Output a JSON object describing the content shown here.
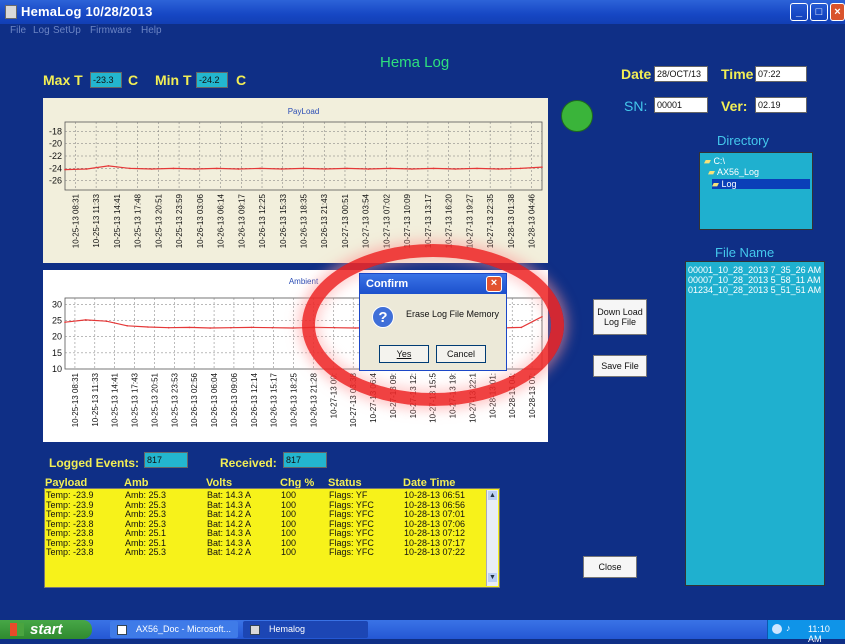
{
  "window": {
    "title": "HemaLog   10/28/2013"
  },
  "menu": [
    "File",
    "Log",
    "SetUp",
    "Firmware",
    "Help"
  ],
  "app_title": "Hema Log",
  "temps": {
    "max_label": "Max T",
    "max_value": "-23.3",
    "min_label": "Min T",
    "min_value": "-24.2",
    "unit": "C"
  },
  "device": {
    "date_label": "Date",
    "date_value": "28/OCT/13",
    "time_label": "Time",
    "time_value": "07:22",
    "sn_label": "SN:",
    "sn_value": "00001",
    "ver_label": "Ver:",
    "ver_value": "02.19"
  },
  "status_color": "#3ab43a",
  "directory": {
    "label": "Directory",
    "items": [
      "C:\\",
      "AX56_Log",
      "Log"
    ]
  },
  "files": {
    "label": "File Name",
    "items": [
      "00001_10_28_2013 7_35_26 AM",
      "00007_10_28_2013 5_58_11 AM",
      "01234_10_28_2013 5_51_51 AM"
    ]
  },
  "chart_data": [
    {
      "type": "line",
      "title": "PayLoad",
      "yticks": [
        -18,
        -20,
        -22,
        -24,
        -26
      ],
      "ylim": [
        -27.5,
        -16.5
      ],
      "xticks": [
        "10-25-13 08:31",
        "10-25-13 11:33",
        "10-25-13 14:41",
        "10-25-13 17:48",
        "10-25-13 20:51",
        "10-25-13 23:59",
        "10-26-13 03:06",
        "10-26-13 06:14",
        "10-26-13 09:17",
        "10-26-13 12:25",
        "10-26-13 15:33",
        "10-26-13 18:35",
        "10-26-13 21:43",
        "10-27-13 00:51",
        "10-27-13 03:54",
        "10-27-13 07:02",
        "10-27-13 10:09",
        "10-27-13 13:17",
        "10-27-13 16:20",
        "10-27-13 19:27",
        "10-27-13 22:35",
        "10-28-13 01:38",
        "10-28-13 04:46"
      ],
      "values": [
        -24.2,
        -24.1,
        -23.6,
        -24.0,
        -24.1,
        -24.0,
        -24.1,
        -24.0,
        -24.1,
        -24.0,
        -24.1,
        -24.0,
        -24.1,
        -24.0,
        -24.1,
        -24.0,
        -24.1,
        -24.0,
        -24.1,
        -24.0,
        -24.1,
        -24.0,
        -23.8
      ],
      "grid": true
    },
    {
      "type": "line",
      "title": "Ambient",
      "yticks": [
        30,
        25,
        20,
        15,
        10
      ],
      "ylim": [
        10,
        32
      ],
      "xticks": [
        "10-25-13 08:31",
        "10-25-13 11:33",
        "10-25-13 14:41",
        "10-25-13 17:43",
        "10-25-13 20:51",
        "10-25-13 23:53",
        "10-26-13 02:56",
        "10-26-13 06:04",
        "10-26-13 09:06",
        "10-26-13 12:14",
        "10-26-13 15:17",
        "10-26-13 18:25",
        "10-26-13 21:28",
        "10-27-13 00:",
        "10-27-13 03:38",
        "10-27-13 06:4",
        "10-27-13 09:",
        "10-27-13 12:",
        "10-27-13 15:5",
        "10-27-13 19:",
        "10-27-13 22:1",
        "10-28-13 01:",
        "10-28-13 04:",
        "10-28-13 07:"
      ],
      "values": [
        24.5,
        25.2,
        24.8,
        23.4,
        23.0,
        22.8,
        22.9,
        22.7,
        22.8,
        22.9,
        22.8,
        22.7,
        22.9,
        22.8,
        22.7,
        22.9,
        22.8,
        22.7,
        22.9,
        22.8,
        22.9,
        22.7,
        22.9,
        26.2
      ],
      "grid": true
    }
  ],
  "dialog": {
    "title": "Confirm",
    "message": "Erase Log File Memory",
    "yes": "Yes",
    "cancel": "Cancel"
  },
  "buttons": {
    "download": "Down Load\nLog File",
    "save": "Save File",
    "close": "Close"
  },
  "events": {
    "logged_label": "Logged Events:",
    "logged_value": "817",
    "received_label": "Received:",
    "received_value": "817"
  },
  "table": {
    "headers": [
      "Payload",
      "Amb",
      "Volts",
      "Chg %",
      "Status",
      "Date  Time"
    ],
    "rows": [
      [
        "Temp: -23.9",
        "Amb: 25.3",
        "Bat: 14.3  A",
        "100",
        "Flags: YF",
        "10-28-13 06:51"
      ],
      [
        "Temp: -23.9",
        "Amb: 25.3",
        "Bat: 14.3  A",
        "100",
        "Flags: YFC",
        "10-28-13 06:56"
      ],
      [
        "Temp: -23.9",
        "Amb: 25.3",
        "Bat: 14.2  A",
        "100",
        "Flags: YFC",
        "10-28-13 07:01"
      ],
      [
        "Temp: -23.8",
        "Amb: 25.3",
        "Bat: 14.2  A",
        "100",
        "Flags: YFC",
        "10-28-13 07:06"
      ],
      [
        "Temp: -23.8",
        "Amb: 25.1",
        "Bat: 14.3  A",
        "100",
        "Flags: YFC",
        "10-28-13 07:12"
      ],
      [
        "Temp: -23.9",
        "Amb: 25.1",
        "Bat: 14.3  A",
        "100",
        "Flags: YFC",
        "10-28-13 07:17"
      ],
      [
        "Temp: -23.8",
        "Amb: 25.3",
        "Bat: 14.2  A",
        "100",
        "Flags: YFC",
        "10-28-13 07:22"
      ]
    ]
  },
  "taskbar": {
    "start": "start",
    "tasks": [
      "AX56_Doc - Microsoft...",
      "Hemalog"
    ],
    "clock": "11:10 AM"
  }
}
